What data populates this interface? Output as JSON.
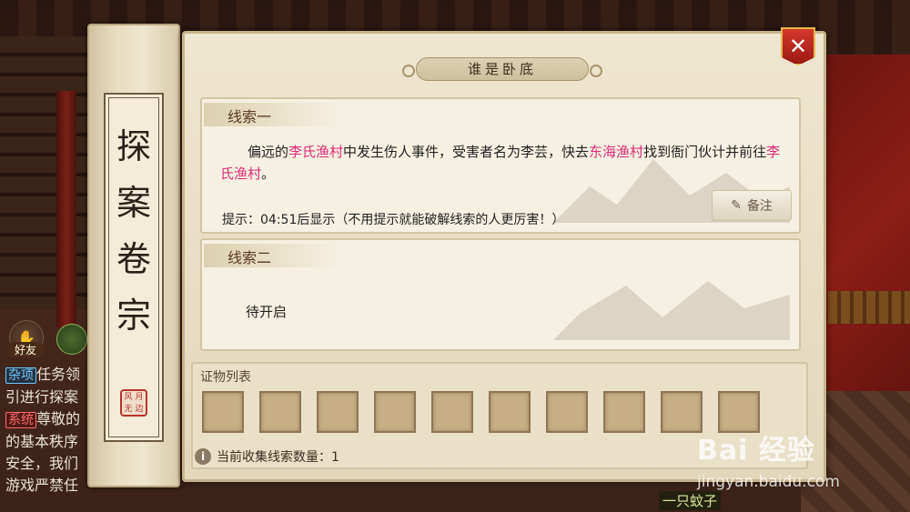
{
  "scroll": {
    "title_chars": [
      "探",
      "案",
      "卷",
      "宗"
    ],
    "seal_text": "风月无边"
  },
  "dialog": {
    "title": "谁是卧底",
    "close_symbol": "✕"
  },
  "clue1": {
    "header": "线索一",
    "text_segments": [
      {
        "text": "偏远的",
        "highlight": false
      },
      {
        "text": "李氏渔村",
        "highlight": true
      },
      {
        "text": "中发生伤人事件，受害者名为李芸，快去",
        "highlight": false
      },
      {
        "text": "东海渔村",
        "highlight": true
      },
      {
        "text": "找到衙门伙计并前往",
        "highlight": false
      },
      {
        "text": "李氏渔村",
        "highlight": true
      },
      {
        "text": "。",
        "highlight": false
      }
    ],
    "hint": "提示：04:51后显示（不用提示就能破解线索的人更厉害！）",
    "note_button": "备注"
  },
  "clue2": {
    "header": "线索二",
    "status": "待开启"
  },
  "evidence": {
    "title": "证物列表",
    "slot_count": 10,
    "count_label": "当前收集线索数量：1"
  },
  "background": {
    "friend_label": "好友",
    "chat_lines": [
      {
        "tag": "杂项",
        "tag_type": "za",
        "text": "任务领"
      },
      {
        "tag": "",
        "tag_type": "",
        "text": "引进行探案"
      },
      {
        "tag": "系统",
        "tag_type": "xi",
        "text": "尊敬的"
      },
      {
        "tag": "",
        "tag_type": "",
        "text": "的基本秩序"
      },
      {
        "tag": "",
        "tag_type": "",
        "text": "安全，我们"
      },
      {
        "tag": "",
        "tag_type": "",
        "text": "游戏严禁任"
      }
    ],
    "mosquito_label": "一只蚊子"
  },
  "watermark": {
    "logo": "Bai 经验",
    "url": "jingyan.baidu.com"
  },
  "colors": {
    "highlight": "#e02a7a",
    "close_red": "#c8261c",
    "panel": "#e9dfc6"
  }
}
